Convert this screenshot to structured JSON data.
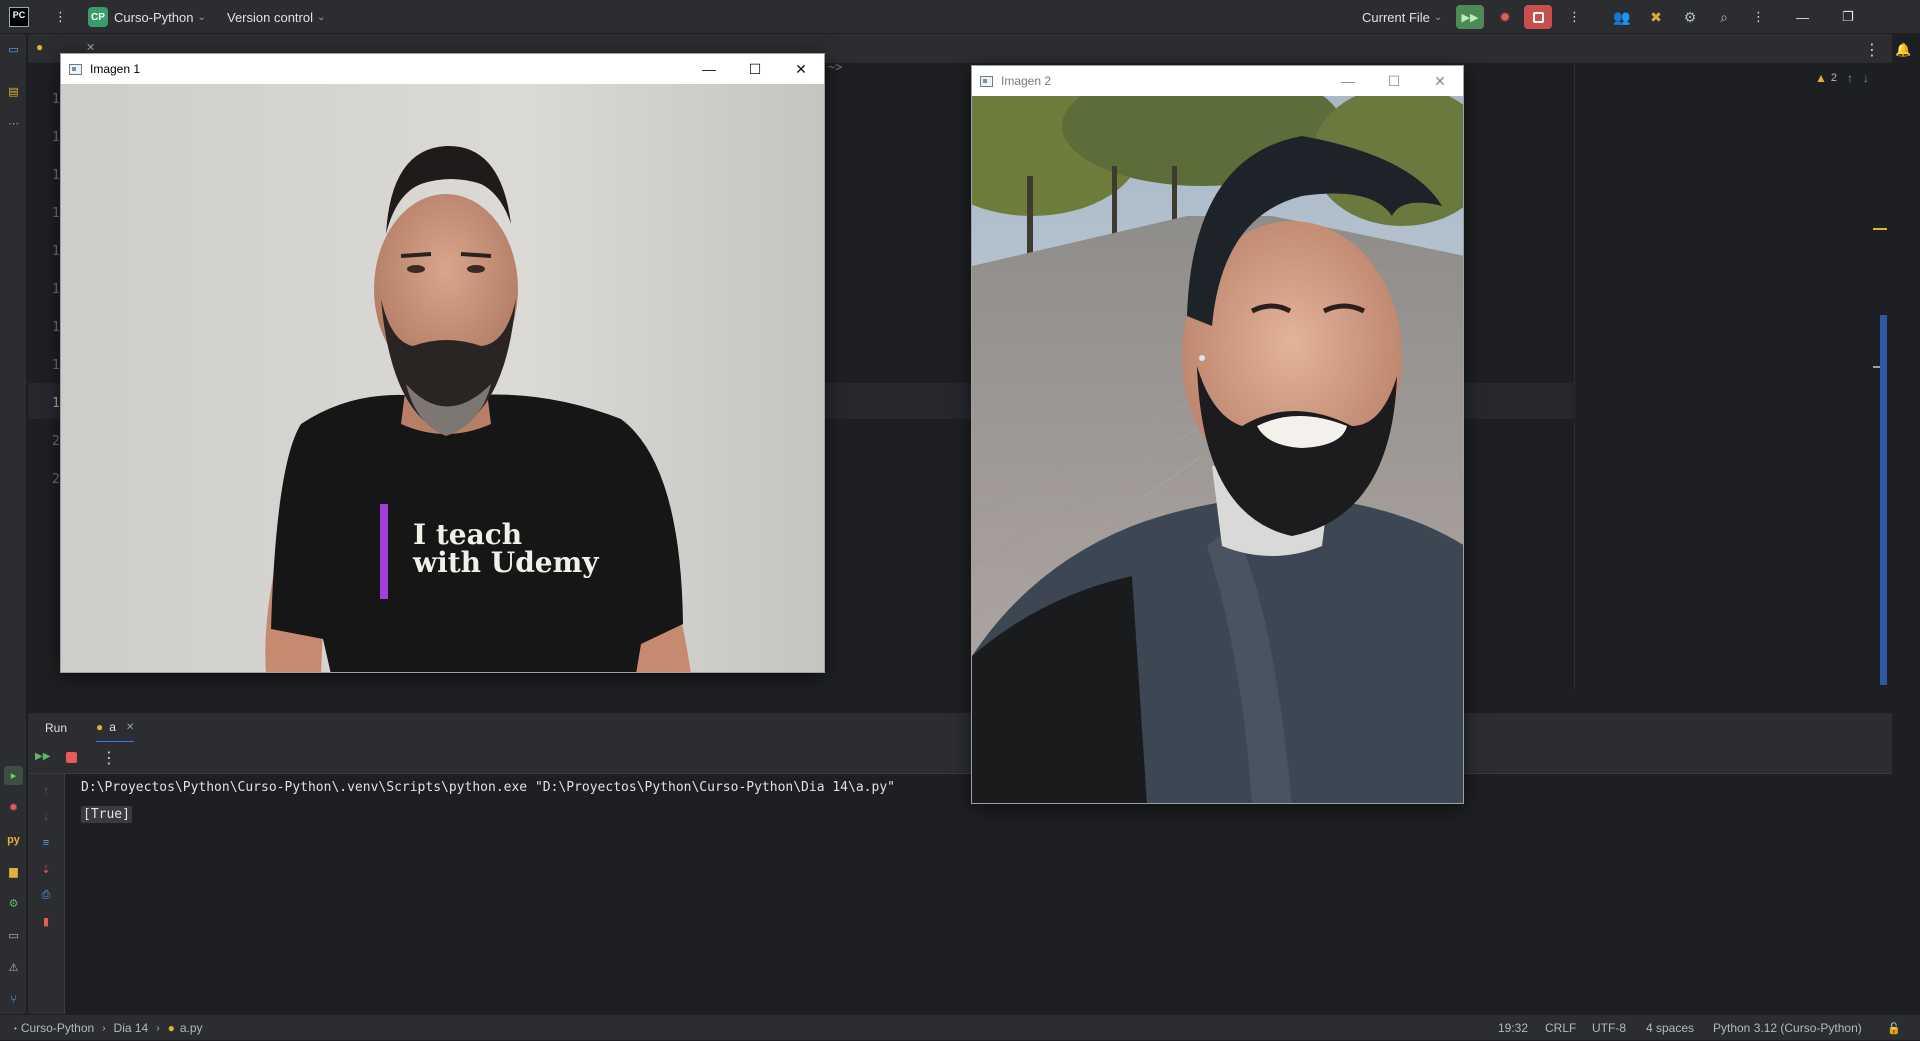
{
  "toolbar": {
    "logo_text": "PC",
    "project_badge": "CP",
    "project_name": "Curso-Python",
    "vcs_label": "Version control",
    "run_config": "Current File",
    "icons": [
      "pycharm-logo-icon",
      "main-menu-icon",
      "run-icon",
      "debug-icon",
      "stop-icon",
      "more-icon",
      "collaborate-icon",
      "build-icon",
      "ai-assistant-icon",
      "search-icon",
      "settings-kebab-icon",
      "minimize-icon",
      "restore-icon"
    ]
  },
  "editor": {
    "line_numbers_visible": [
      "1",
      "1",
      "1",
      "1",
      "1",
      "1",
      "1",
      "1",
      "1",
      "2",
      "2"
    ],
    "warnings_count": "2",
    "fragment": "~>"
  },
  "run_panel": {
    "tab_run": "Run",
    "tab_config": "a",
    "command": "D:\\Proyectos\\Python\\Curso-Python\\.venv\\Scripts\\python.exe \"D:\\Proyectos\\Python\\Curso-Python\\Dia 14\\a.py\"",
    "output": "[True]"
  },
  "windows": {
    "img1_title": "Imagen 1",
    "img1_shirt_line1": "I teach",
    "img1_shirt_line2": "with Udemy",
    "img2_title": "Imagen 2"
  },
  "statusbar": {
    "crumb_project": "Curso-Python",
    "crumb_folder": "Dia 14",
    "crumb_file": "a.py",
    "position": "19:32",
    "line_sep": "CRLF",
    "encoding": "UTF-8",
    "indent": "4 spaces",
    "interpreter": "Python 3.12 (Curso-Python)"
  },
  "colors": {
    "bg": "#1e1f22",
    "panel": "#2b2d30",
    "accent_green": "#4e8a55",
    "accent_red": "#c94f4f",
    "project_badge": "#3b9b6c"
  }
}
